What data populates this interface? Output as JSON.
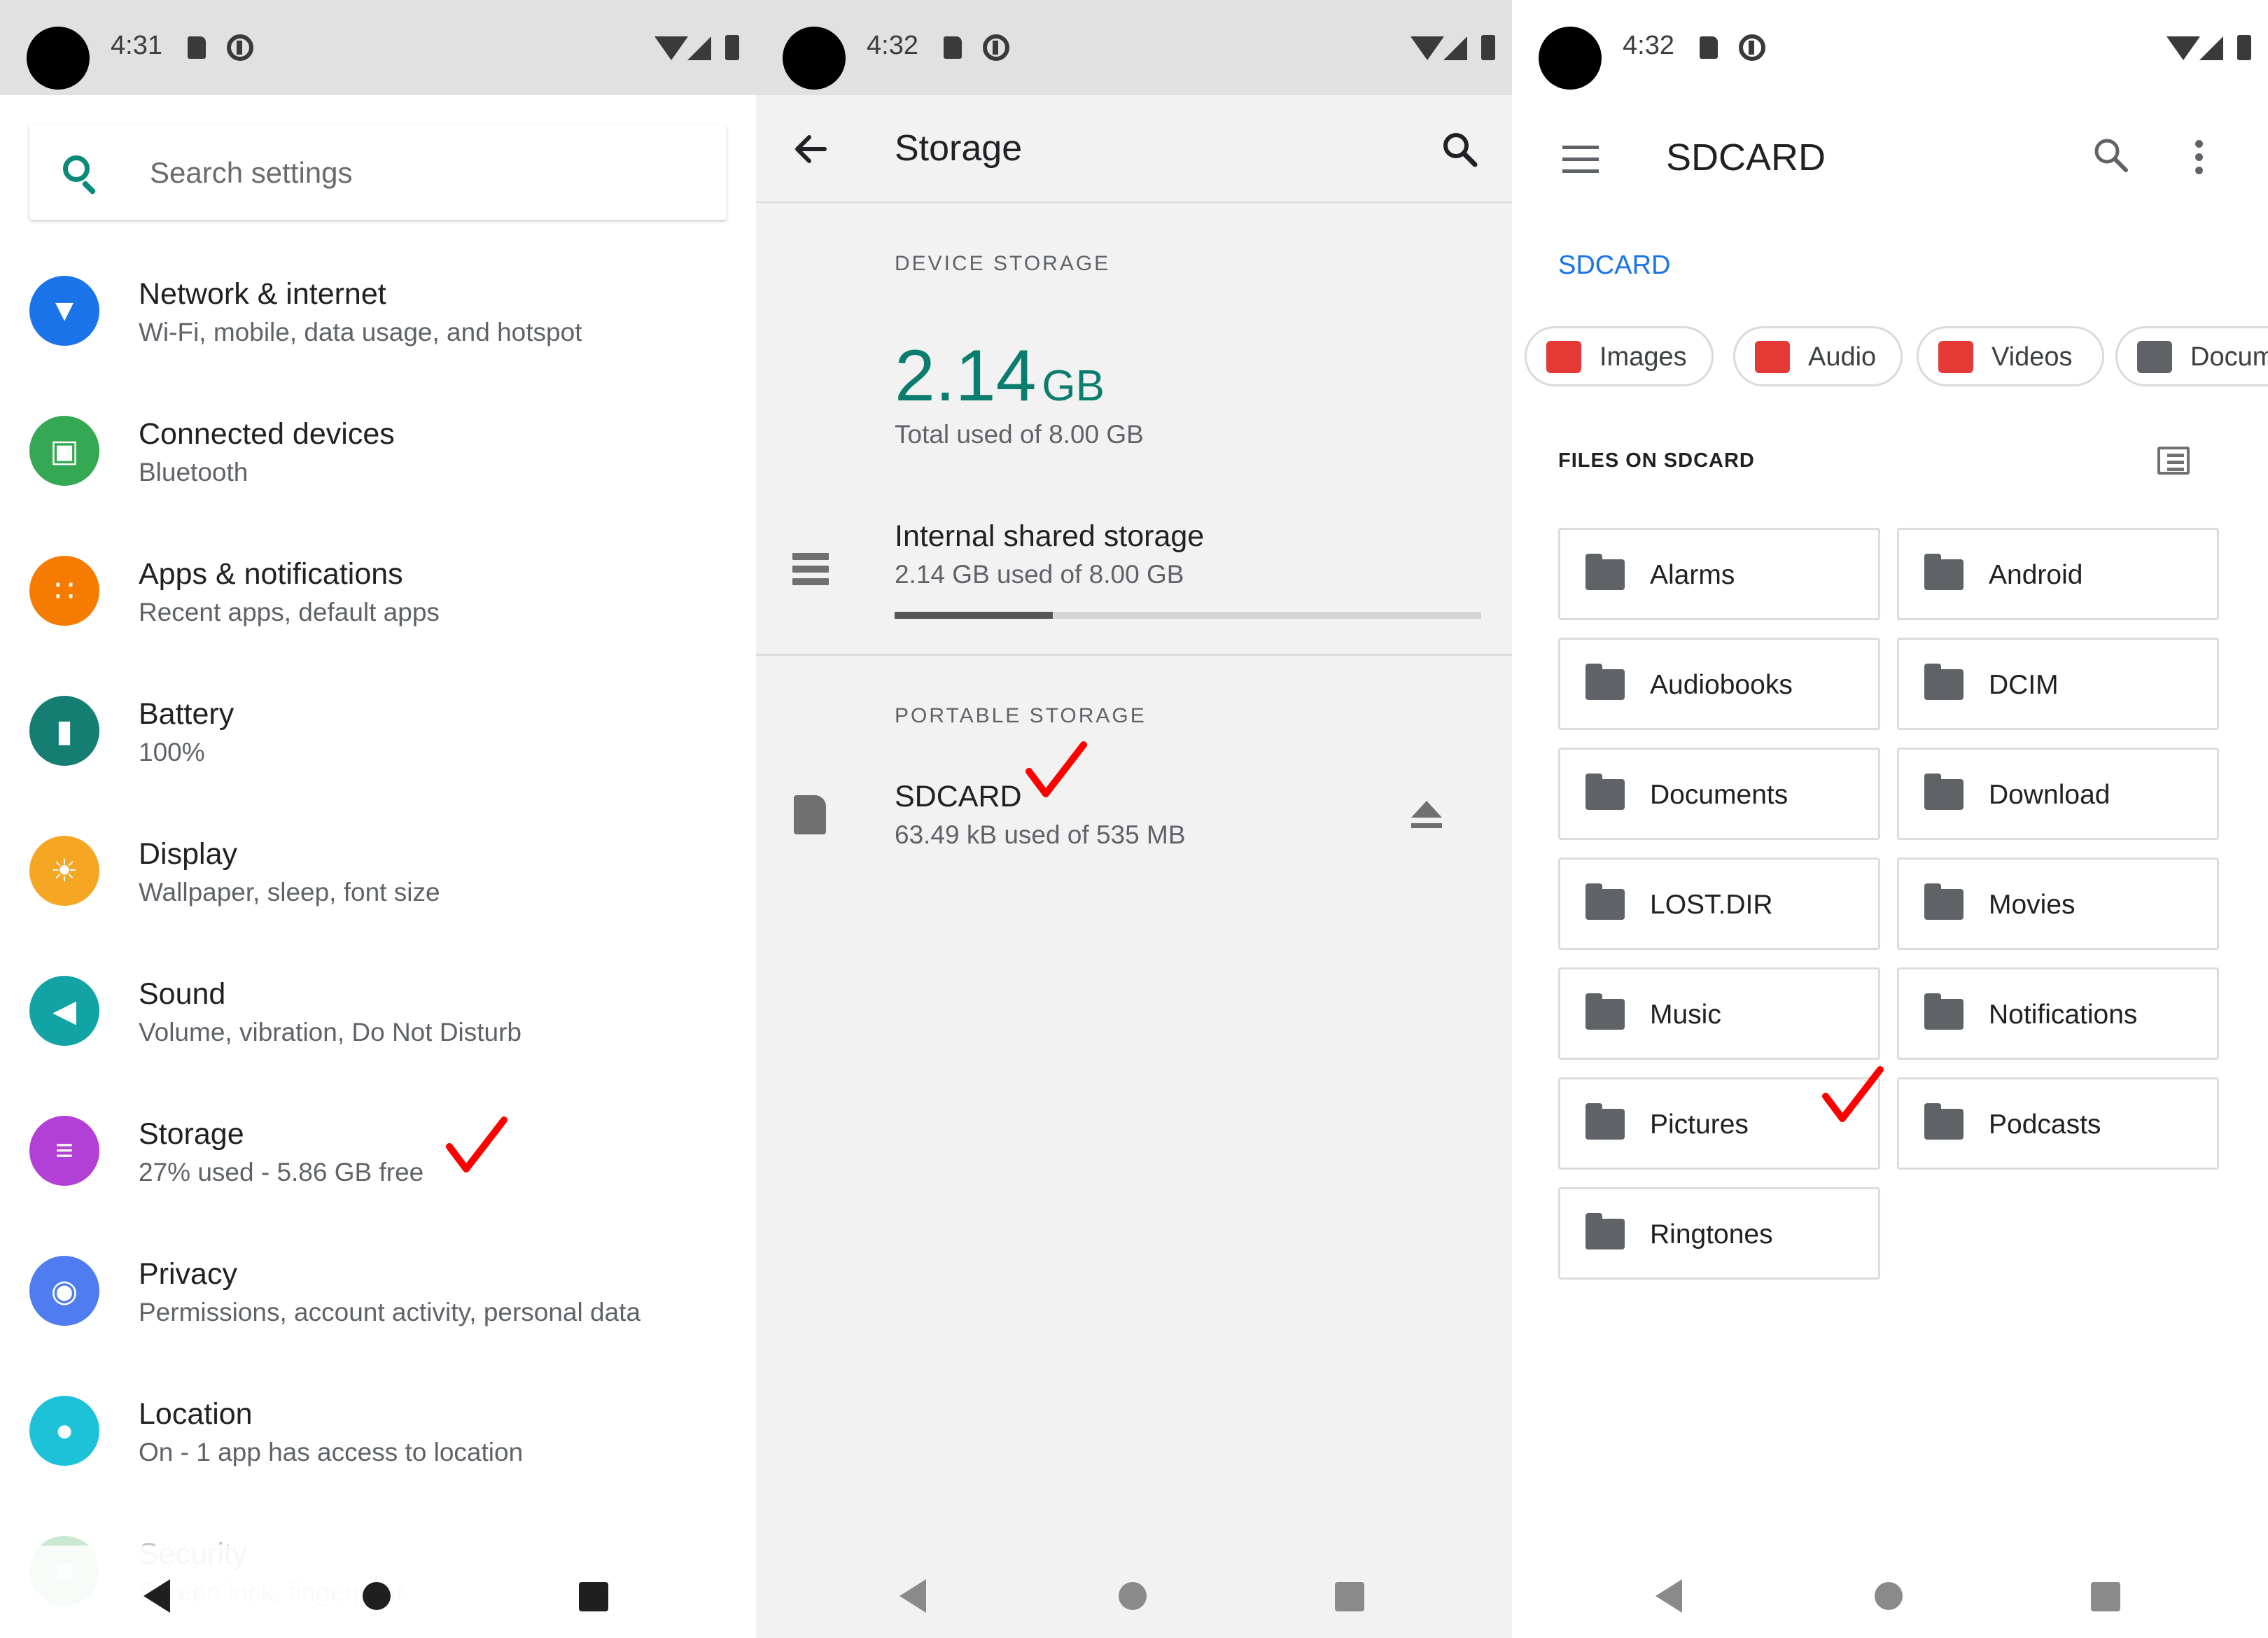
{
  "settings_screen": {
    "status": {
      "time": "4:31"
    },
    "search_placeholder": "Search settings",
    "items": [
      {
        "title": "Network & internet",
        "subtitle": "Wi-Fi, mobile, data usage, and hotspot",
        "color": "#1a73e8",
        "icon": "wifi-icon"
      },
      {
        "title": "Connected devices",
        "subtitle": "Bluetooth",
        "color": "#34a853",
        "icon": "devices-icon"
      },
      {
        "title": "Apps & notifications",
        "subtitle": "Recent apps, default apps",
        "color": "#f57c00",
        "icon": "apps-icon"
      },
      {
        "title": "Battery",
        "subtitle": "100%",
        "color": "#137e71",
        "icon": "battery-icon"
      },
      {
        "title": "Display",
        "subtitle": "Wallpaper, sleep, font size",
        "color": "#f5a623",
        "icon": "brightness-icon"
      },
      {
        "title": "Sound",
        "subtitle": "Volume, vibration, Do Not Disturb",
        "color": "#12a4a4",
        "icon": "volume-icon"
      },
      {
        "title": "Storage",
        "subtitle": "27% used - 5.86 GB free",
        "color": "#b23fd6",
        "icon": "storage-icon"
      },
      {
        "title": "Privacy",
        "subtitle": "Permissions, account activity, personal data",
        "color": "#4f7df0",
        "icon": "eye-icon"
      },
      {
        "title": "Location",
        "subtitle": "On - 1 app has access to location",
        "color": "#1ec2d8",
        "icon": "location-pin-icon"
      },
      {
        "title": "Security",
        "subtitle": "Screen lock, fingerprint",
        "color": "#34a853",
        "icon": "lock-icon"
      }
    ]
  },
  "storage_screen": {
    "status": {
      "time": "4:32"
    },
    "title": "Storage",
    "device_storage_label": "DEVICE STORAGE",
    "used_amount": "2.14",
    "used_unit": "GB",
    "total_used": "Total used of 8.00 GB",
    "internal": {
      "title": "Internal shared storage",
      "subtitle": "2.14 GB used of 8.00 GB",
      "used_fraction": 0.27
    },
    "portable_storage_label": "PORTABLE STORAGE",
    "sdcard": {
      "title": "SDCARD",
      "subtitle": "63.49 kB used of 535 MB"
    }
  },
  "files_screen": {
    "status": {
      "time": "4:32"
    },
    "title": "SDCARD",
    "breadcrumb": "SDCARD",
    "chips": [
      {
        "label": "Images",
        "icon": "image-icon",
        "color": "#e53935"
      },
      {
        "label": "Audio",
        "icon": "headphones-icon",
        "color": "#e53935"
      },
      {
        "label": "Videos",
        "icon": "clapperboard-icon",
        "color": "#e53935"
      },
      {
        "label": "Documents",
        "icon": "document-icon",
        "color": "#5f6368"
      }
    ],
    "files_label": "FILES ON SDCARD",
    "folders": [
      "Alarms",
      "Android",
      "Audiobooks",
      "DCIM",
      "Documents",
      "Download",
      "LOST.DIR",
      "Movies",
      "Music",
      "Notifications",
      "Pictures",
      "Podcasts",
      "Ringtones"
    ]
  },
  "colors": {
    "accent": "#0b7d6e",
    "link": "#1a73e8",
    "checkmark": "#ff0000"
  }
}
